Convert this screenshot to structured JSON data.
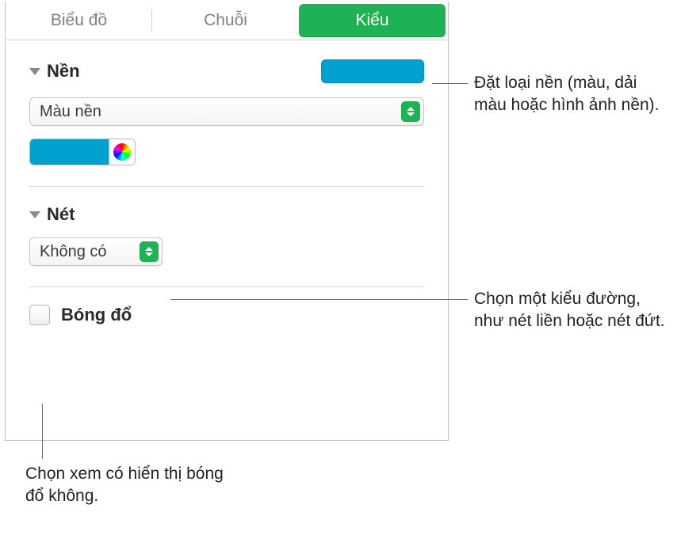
{
  "tabs": {
    "chart": "Biểu đồ",
    "series": "Chuỗi",
    "style": "Kiểu"
  },
  "background": {
    "header": "Nền",
    "fill_type": "Màu nền",
    "color_hex": "#00a0cf"
  },
  "stroke": {
    "header": "Nét",
    "value": "Không có"
  },
  "shadow": {
    "label": "Bóng đổ"
  },
  "callouts": {
    "bg": "Đặt loại nền (màu, dải màu hoặc hình ảnh nền).",
    "stroke": "Chọn một kiểu đường, như nét liền hoặc nét đứt.",
    "shadow": "Chọn xem có hiển thị bóng đổ không."
  }
}
